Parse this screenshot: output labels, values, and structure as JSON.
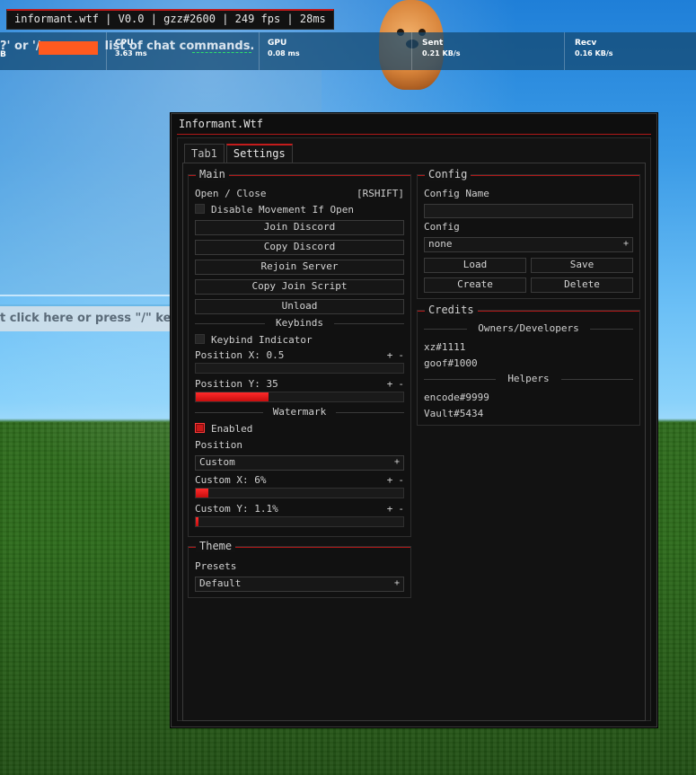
{
  "overlay": {
    "watermark": "informant.wtf | V0.0 | gzz#2600 | 249 fps | 28ms",
    "chat_hint_top": "?' or '/",
    "chat_hint_top_tail": "list of chat commands.",
    "chat_hint_top_b": "B",
    "chat_bar_text": "t click here or press \"/\" key",
    "stats": [
      {
        "label": "CPU",
        "value": "3.63 ms"
      },
      {
        "label": "GPU",
        "value": "0.08 ms"
      },
      {
        "label": "Sent",
        "value": "0.21 KB/s"
      },
      {
        "label": "Recv",
        "value": "0.16 KB/s"
      }
    ]
  },
  "window": {
    "title": "Informant.Wtf",
    "tabs": [
      {
        "label": "Tab1"
      },
      {
        "label": "Settings"
      }
    ],
    "active_tab": "Settings"
  },
  "main": {
    "title": "Main",
    "open_close_label": "Open / Close",
    "open_close_key": "[RSHIFT]",
    "disable_movement": {
      "label": "Disable Movement If Open",
      "checked": false
    },
    "buttons": [
      "Join Discord",
      "Copy Discord",
      "Rejoin Server",
      "Copy Join Script",
      "Unload"
    ],
    "keybinds_header": "Keybinds",
    "keybind_indicator": {
      "label": "Keybind Indicator",
      "checked": false
    },
    "position_x": {
      "label": "Position X: 0.5",
      "value": 0.5,
      "fill": 0
    },
    "position_y": {
      "label": "Position Y: 35",
      "value": 35,
      "fill": 0.35
    },
    "watermark_header": "Watermark",
    "watermark_enabled": {
      "label": "Enabled",
      "checked": true
    },
    "position_label": "Position",
    "position_select": "Custom",
    "custom_x": {
      "label": "Custom X: 6%",
      "value": 6,
      "fill": 0.06
    },
    "custom_y": {
      "label": "Custom Y: 1.1%",
      "value": 1.1,
      "fill": 0.011
    },
    "plus": "+",
    "minus": "-"
  },
  "theme": {
    "title": "Theme",
    "presets_label": "Presets",
    "presets_select": "Default",
    "plus_glyph": "+"
  },
  "config": {
    "title": "Config",
    "name_label": "Config Name",
    "name_value": "",
    "config_label": "Config",
    "config_select": "none",
    "buttons": {
      "load": "Load",
      "save": "Save",
      "create": "Create",
      "delete": "Delete"
    }
  },
  "credits": {
    "title": "Credits",
    "owners_header": "Owners/Developers",
    "owners": [
      "xz#1111",
      "goof#1000"
    ],
    "helpers_header": "Helpers",
    "helpers": [
      "encode#9999",
      "Vault#5434"
    ]
  },
  "colors": {
    "accent": "#c41c1c",
    "window_bg": "#121212",
    "border": "#3a3a3a"
  }
}
